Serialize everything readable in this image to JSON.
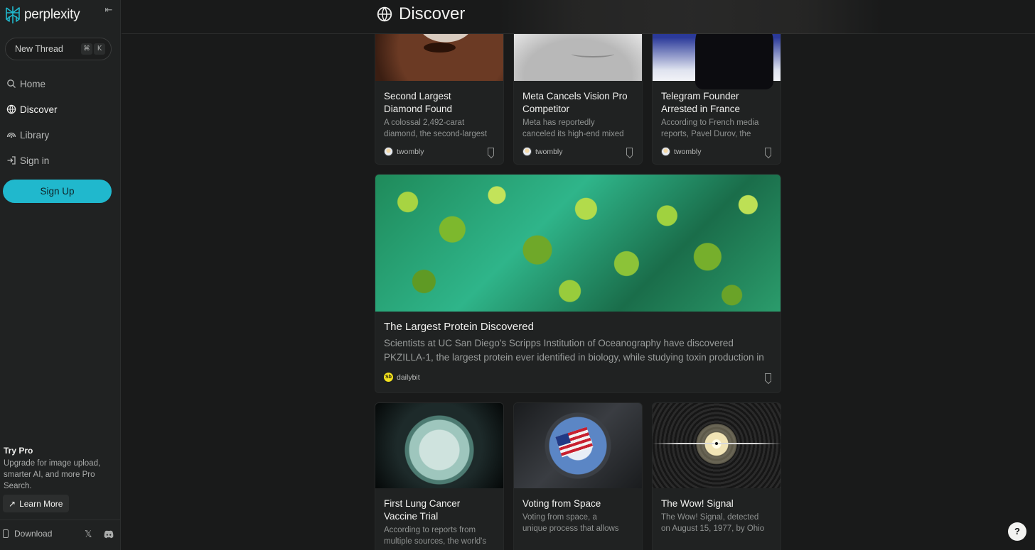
{
  "app": {
    "brand": "perplexity",
    "accent_color": "#20b8cd"
  },
  "sidebar": {
    "new_thread": {
      "label": "New Thread",
      "shortcut_keys": [
        "⌘",
        "K"
      ]
    },
    "nav": [
      {
        "label": "Home",
        "icon": "search-icon",
        "active": false
      },
      {
        "label": "Discover",
        "icon": "globe-icon",
        "active": true
      },
      {
        "label": "Library",
        "icon": "library-icon",
        "active": false
      },
      {
        "label": "Sign in",
        "icon": "sign-in-icon",
        "active": false
      }
    ],
    "signup_label": "Sign Up",
    "promo": {
      "title": "Try Pro",
      "description": "Upgrade for image upload, smarter AI, and more Pro Search.",
      "button_label": "Learn More"
    },
    "footer": {
      "download_label": "Download"
    }
  },
  "header": {
    "title": "Discover"
  },
  "feed": {
    "top_row": [
      {
        "title_lines": [
          "Second Largest",
          "Diamond Found"
        ],
        "desc_lines": [
          "A colossal 2,492-carat",
          "diamond, the second-largest"
        ],
        "author": "twombly"
      },
      {
        "title_lines": [
          "Meta Cancels Vision Pro",
          "Competitor"
        ],
        "desc_lines": [
          "Meta has reportedly",
          "canceled its high-end mixed"
        ],
        "author": "twombly"
      },
      {
        "title_lines": [
          "Telegram Founder",
          "Arrested in France"
        ],
        "desc_lines": [
          "According to French media",
          "reports, Pavel Durov, the"
        ],
        "author": "twombly"
      }
    ],
    "featured": {
      "title": "The Largest Protein Discovered",
      "desc_lines": [
        "Scientists at UC San Diego's Scripps Institution of Oceanography have discovered",
        "PKZILLA-1, the largest protein ever identified in biology, while studying toxin production in"
      ],
      "author": "dailybit"
    },
    "bottom_row": [
      {
        "title_lines": [
          "First Lung Cancer",
          "Vaccine Trial"
        ],
        "desc_lines": [
          "According to reports from",
          "multiple sources, the world's"
        ]
      },
      {
        "title_lines": [
          "Voting from Space"
        ],
        "desc_lines": [
          "Voting from space, a",
          "unique process that allows"
        ]
      },
      {
        "title_lines": [
          "The Wow! Signal"
        ],
        "desc_lines": [
          "The Wow! Signal, detected",
          "on August 15, 1977, by Ohio"
        ]
      }
    ]
  },
  "help_label": "?"
}
